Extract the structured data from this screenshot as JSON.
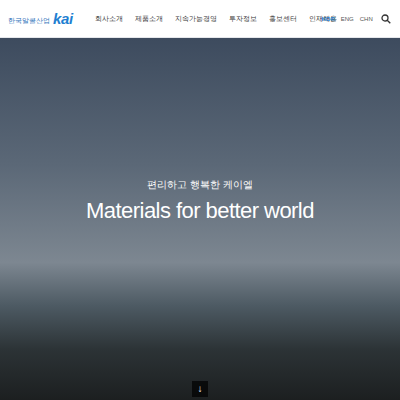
{
  "logo": {
    "company": "한국알콜산업",
    "brand": "kai"
  },
  "nav": [
    "회사소개",
    "제품소개",
    "지속가능경영",
    "투자정보",
    "홍보센터",
    "인재채용"
  ],
  "languages": [
    {
      "label": "KOR",
      "selected": true
    },
    {
      "label": "ENG",
      "selected": false
    },
    {
      "label": "CHN",
      "selected": false
    }
  ],
  "hero": {
    "subtitle": "편리하고 행복한 케이엘",
    "title": "Materials for better world"
  },
  "scroll_button": "↓"
}
